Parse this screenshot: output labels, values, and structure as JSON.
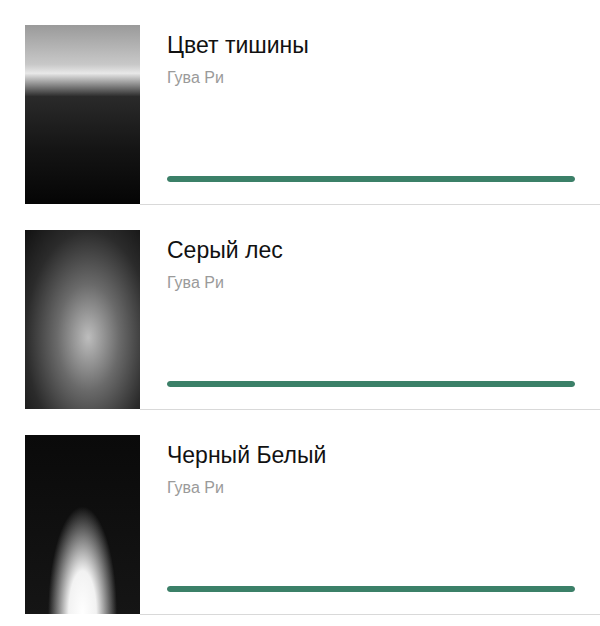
{
  "books": [
    {
      "title": "Цвет тишины",
      "author": "Гува Ри",
      "level": 1
    },
    {
      "title": "Серый лес",
      "author": "Гува Ри",
      "level": 1
    },
    {
      "title": "Черный Белый",
      "author": "Гува Ри",
      "level": 1
    }
  ]
}
